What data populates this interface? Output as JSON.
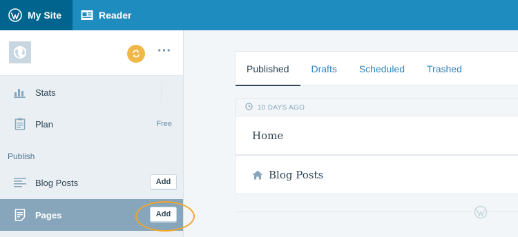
{
  "topbar": {
    "my_site": "My Site",
    "reader": "Reader"
  },
  "sidebar": {
    "items": [
      {
        "label": "Stats",
        "icon": "stats-icon"
      },
      {
        "label": "Plan",
        "meta": "Free",
        "icon": "plan-icon"
      }
    ],
    "section_title": "Publish",
    "publish_items": [
      {
        "label": "Blog Posts",
        "action": "Add",
        "icon": "posts-icon"
      },
      {
        "label": "Pages",
        "action": "Add",
        "icon": "pages-icon",
        "selected": true
      }
    ]
  },
  "main": {
    "tabs": [
      {
        "label": "Published",
        "active": true
      },
      {
        "label": "Drafts"
      },
      {
        "label": "Scheduled"
      },
      {
        "label": "Trashed"
      }
    ],
    "date_header": "10 DAYS AGO",
    "pages": [
      {
        "title": "Home"
      },
      {
        "title": "Blog Posts",
        "is_front_page": true
      }
    ]
  },
  "colors": {
    "topbar": "#1e8cbe",
    "topbar_active": "#00658e",
    "sidebar_selected": "#87a6bc",
    "link": "#2e86c1",
    "highlight_ring": "#f0a52c",
    "sync_badge": "#f0b849"
  }
}
